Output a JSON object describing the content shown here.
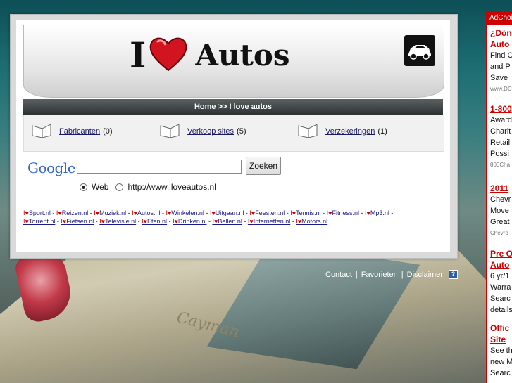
{
  "logo": {
    "i": "I",
    "word": "Autos"
  },
  "navbar": {
    "text": "Home >> I love autos"
  },
  "categories": [
    {
      "label": "Fabricanten",
      "count": "(0)"
    },
    {
      "label": "Verkoop sites",
      "count": "(5)"
    },
    {
      "label": "Verzekeringen",
      "count": "(1)"
    }
  ],
  "search": {
    "google_label": "Google",
    "tm": "TM",
    "input_value": "",
    "button_label": "Zoeken",
    "radio_web": "Web",
    "radio_site": "http://www.iloveautos.nl"
  },
  "links_row1": [
    "Sport.nl",
    "Reizen.nl",
    "Muziek.nl",
    "Autos.nl",
    "Winkelen.nl",
    "Uitgaan.nl",
    "Feesten.nl",
    "Tennis.nl",
    "Fitness.nl",
    "Mp3.nl"
  ],
  "links_row2": [
    "Torrent.nl",
    "Fietsen.nl",
    "Televisie.nl",
    "Eten.nl",
    "Drinken.nl",
    "Bellen.nl",
    "Internetten.nl",
    "Motors.nl"
  ],
  "love_prefix": "I♥",
  "footer": {
    "contact": "Contact",
    "favorieten": "Favorieten",
    "disclaimer": "Disclaimer",
    "help": "?"
  },
  "ads": {
    "header": "AdChoices",
    "items": [
      {
        "title1": "¿Dónde",
        "title2": "Auto",
        "lines": [
          "Find C",
          "and P",
          "Save"
        ],
        "url": "www.DC"
      },
      {
        "title1": "1-800",
        "lines": [
          "Award",
          "Charit",
          "Retail",
          "Possi"
        ],
        "url": "800Cha"
      },
      {
        "title1": "2011",
        "lines": [
          "Chevr",
          "Move",
          "Great"
        ],
        "url": "Chevro"
      },
      {
        "title1": "Pre O",
        "title2": "Auto",
        "lines": [
          "6 yr/1",
          "Warra",
          "Searc",
          "details"
        ]
      },
      {
        "title1": "Offic",
        "title2": "Site",
        "lines": [
          "See th",
          "new M",
          "Searc"
        ]
      }
    ]
  },
  "colors": {
    "accent": "#cc0000",
    "link": "#1a1a66",
    "navbar": "#2d3233"
  },
  "icons": [
    "heart-icon",
    "car-icon",
    "folder-icon",
    "help-icon"
  ]
}
